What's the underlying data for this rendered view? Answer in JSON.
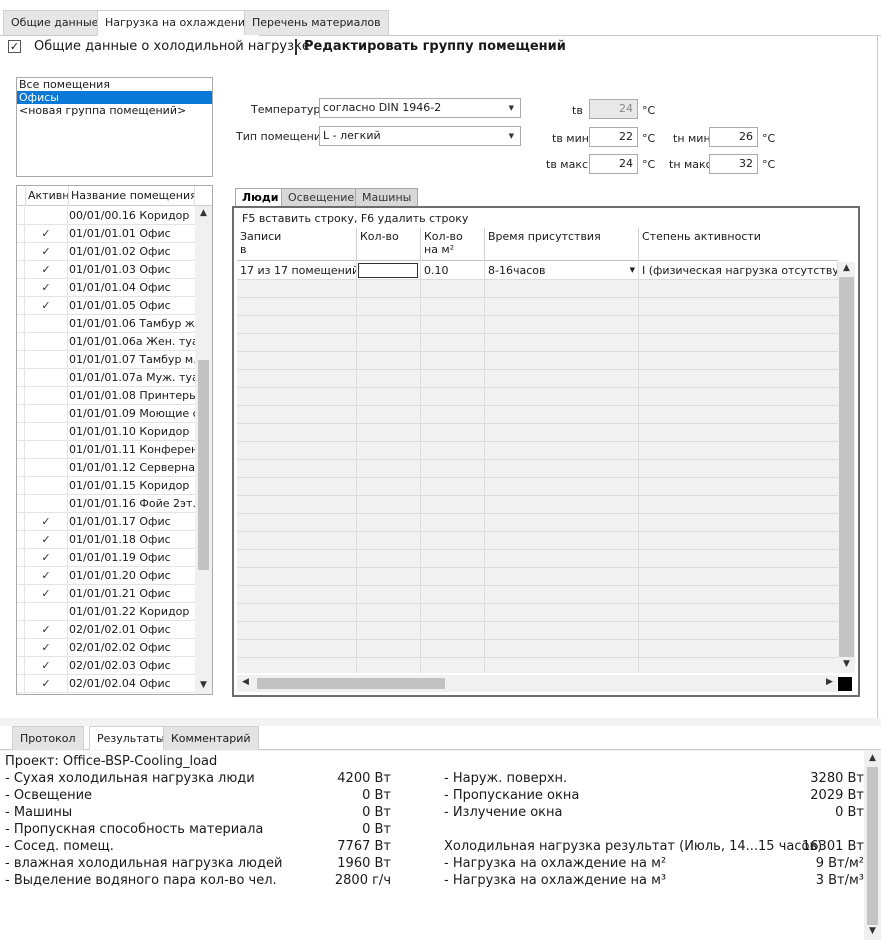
{
  "top_tabs": [
    "Общие данные",
    "Нагрузка на охлаждение",
    "Перечень материалов"
  ],
  "header": {
    "title": "Общие данные о холодильной нагрузке",
    "link": "Редактировать группу помещений"
  },
  "groups": [
    "Все помещения",
    "Офисы",
    "<новая группа помещений>"
  ],
  "params": {
    "temp_label": "Температура",
    "temp_value": "согласно DIN 1946-2",
    "room_type_label": "Тип помещения",
    "room_type_value": "L - легкий",
    "tv_label": "tв",
    "tv_value": "24",
    "tv_min_label": "tв мин",
    "tv_min_value": "22",
    "tv_max_label": "tв макс",
    "tv_max_value": "24",
    "tn_min_label": "tн мин",
    "tn_min_value": "26",
    "tn_max_label": "tн макс",
    "tn_max_value": "32",
    "unit": "°C"
  },
  "rooms": {
    "col_active": "Активно",
    "col_name": "Название помещения",
    "rows": [
      {
        "active": "",
        "name": "00/01/00.16 Коридор"
      },
      {
        "active": "✓",
        "name": "01/01/01.01 Офис"
      },
      {
        "active": "✓",
        "name": "01/01/01.02 Офис"
      },
      {
        "active": "✓",
        "name": "01/01/01.03 Офис"
      },
      {
        "active": "✓",
        "name": "01/01/01.04 Офис"
      },
      {
        "active": "✓",
        "name": "01/01/01.05 Офис"
      },
      {
        "active": "",
        "name": "01/01/01.06 Тамбур ж..."
      },
      {
        "active": "",
        "name": "01/01/01.06a Жен. туа..."
      },
      {
        "active": "",
        "name": "01/01/01.07 Тамбур м..."
      },
      {
        "active": "",
        "name": "01/01/01.07a Муж. туа..."
      },
      {
        "active": "",
        "name": "01/01/01.08 Принтеры..."
      },
      {
        "active": "",
        "name": "01/01/01.09 Моющие с..."
      },
      {
        "active": "",
        "name": "01/01/01.10 Коридор"
      },
      {
        "active": "",
        "name": "01/01/01.11 Конферен..."
      },
      {
        "active": "",
        "name": "01/01/01.12 Серверна..."
      },
      {
        "active": "",
        "name": "01/01/01.15 Коридор"
      },
      {
        "active": "",
        "name": "01/01/01.16 Фойе 2эт."
      },
      {
        "active": "✓",
        "name": "01/01/01.17 Офис"
      },
      {
        "active": "✓",
        "name": "01/01/01.18 Офис"
      },
      {
        "active": "✓",
        "name": "01/01/01.19 Офис"
      },
      {
        "active": "✓",
        "name": "01/01/01.20 Офис"
      },
      {
        "active": "✓",
        "name": "01/01/01.21 Офис"
      },
      {
        "active": "",
        "name": "01/01/01.22 Коридор"
      },
      {
        "active": "✓",
        "name": "02/01/02.01 Офис"
      },
      {
        "active": "✓",
        "name": "02/01/02.02 Офис"
      },
      {
        "active": "✓",
        "name": "02/01/02.03 Офис"
      },
      {
        "active": "✓",
        "name": "02/01/02.04 Офис"
      }
    ]
  },
  "sub_tabs": [
    "Люди",
    "Освещение",
    "Машины"
  ],
  "people": {
    "hint": "F5 вставить строку, F6 удалить строку",
    "col_records": "Записи\nв",
    "col_count": "Кол-во",
    "col_per_m2": "Кол-во\nна м²",
    "col_time": "Время присутствия",
    "col_activity": "Степень активности",
    "row": {
      "records": "17 из 17 помещений",
      "count": "",
      "per_m2": "0.10",
      "time": "8-16часов",
      "activity": "I (физическая нагрузка отсутствует)"
    }
  },
  "bottom_tabs": [
    "Протокол",
    "Результаты",
    "Комментарий"
  ],
  "results": {
    "project": "Проект: Office-BSP-Cooling_load",
    "left": [
      {
        "label": "- Сухая холодильная нагрузка люди",
        "value": "4200 Вт"
      },
      {
        "label": "- Освещение",
        "value": "0 Вт"
      },
      {
        "label": "- Машины",
        "value": "0 Вт"
      },
      {
        "label": "- Пропускная способность материала",
        "value": "0 Вт"
      },
      {
        "label": "- Сосед. помещ.",
        "value": "7767 Вт"
      },
      {
        "label": "- влажная холодильная нагрузка людей",
        "value": "1960 Вт"
      },
      {
        "label": "- Выделение водяного пара кол-во чел.",
        "value": "2800 г/ч"
      }
    ],
    "right": [
      {
        "label": "- Наруж. поверхн.",
        "value": "3280 Вт"
      },
      {
        "label": "- Пропускание окна",
        "value": "2029 Вт"
      },
      {
        "label": "- Излучение окна",
        "value": "0 Вт"
      },
      {
        "label": "",
        "value": ""
      },
      {
        "label": "Холодильная нагрузка результат (Июль, 14...15 часов)",
        "value": "16301 Вт"
      },
      {
        "label": "- Нагрузка на охлаждение на м²",
        "value": "9 Вт/м²"
      },
      {
        "label": "- Нагрузка на охлаждение на м³",
        "value": "3 Вт/м³"
      }
    ]
  }
}
